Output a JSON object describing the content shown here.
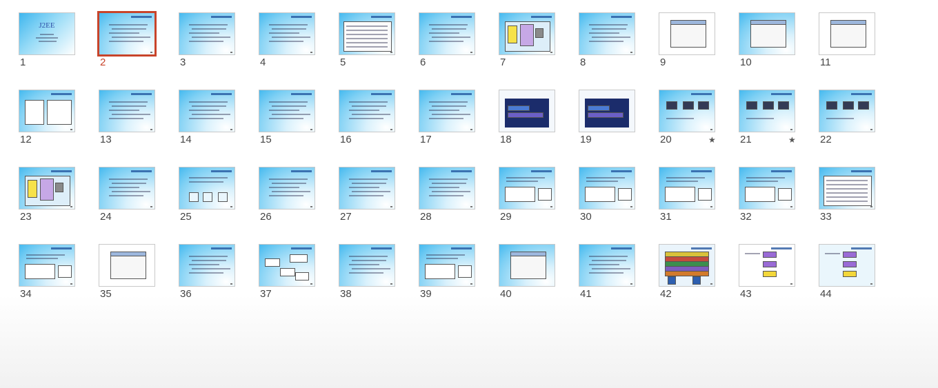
{
  "selected_slide": 2,
  "cover_title": "J2EE",
  "slides": [
    {
      "number": "1",
      "kind": "title"
    },
    {
      "number": "2",
      "kind": "text"
    },
    {
      "number": "3",
      "kind": "text"
    },
    {
      "number": "4",
      "kind": "text"
    },
    {
      "number": "5",
      "kind": "table"
    },
    {
      "number": "6",
      "kind": "text"
    },
    {
      "number": "7",
      "kind": "diagram"
    },
    {
      "number": "8",
      "kind": "text"
    },
    {
      "number": "9",
      "kind": "screenshot"
    },
    {
      "number": "10",
      "kind": "screenshot"
    },
    {
      "number": "11",
      "kind": "screenshot"
    },
    {
      "number": "12",
      "kind": "screens"
    },
    {
      "number": "13",
      "kind": "text"
    },
    {
      "number": "14",
      "kind": "text"
    },
    {
      "number": "15",
      "kind": "text"
    },
    {
      "number": "16",
      "kind": "text"
    },
    {
      "number": "17",
      "kind": "text"
    },
    {
      "number": "18",
      "kind": "dark"
    },
    {
      "number": "19",
      "kind": "dark"
    },
    {
      "number": "20",
      "kind": "devices",
      "star": "★"
    },
    {
      "number": "21",
      "kind": "devices",
      "star": "★"
    },
    {
      "number": "22",
      "kind": "devices"
    },
    {
      "number": "23",
      "kind": "diagram"
    },
    {
      "number": "24",
      "kind": "text"
    },
    {
      "number": "25",
      "kind": "boxes"
    },
    {
      "number": "26",
      "kind": "text"
    },
    {
      "number": "27",
      "kind": "text"
    },
    {
      "number": "28",
      "kind": "text"
    },
    {
      "number": "29",
      "kind": "code"
    },
    {
      "number": "30",
      "kind": "code"
    },
    {
      "number": "31",
      "kind": "code"
    },
    {
      "number": "32",
      "kind": "code"
    },
    {
      "number": "33",
      "kind": "table"
    },
    {
      "number": "34",
      "kind": "code"
    },
    {
      "number": "35",
      "kind": "screenshot"
    },
    {
      "number": "36",
      "kind": "text"
    },
    {
      "number": "37",
      "kind": "bubbles"
    },
    {
      "number": "38",
      "kind": "text"
    },
    {
      "number": "39",
      "kind": "code"
    },
    {
      "number": "40",
      "kind": "screenshot"
    },
    {
      "number": "41",
      "kind": "text"
    },
    {
      "number": "42",
      "kind": "stack"
    },
    {
      "number": "43",
      "kind": "flow"
    },
    {
      "number": "44",
      "kind": "flow"
    }
  ]
}
